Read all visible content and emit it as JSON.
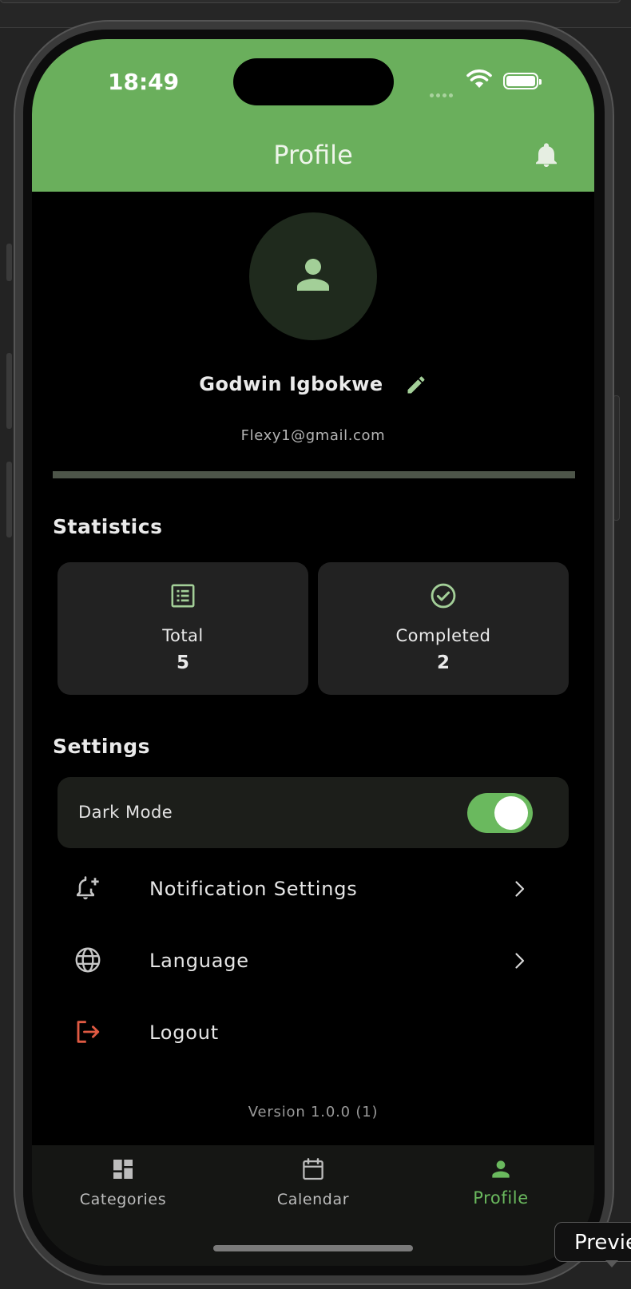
{
  "status_bar": {
    "time": "18:49"
  },
  "appbar": {
    "title": "Profile"
  },
  "profile": {
    "name": "Godwin Igbokwe",
    "email": "Flexy1@gmail.com"
  },
  "statistics": {
    "title": "Statistics",
    "total_label": "Total",
    "total_value": "5",
    "completed_label": "Completed",
    "completed_value": "2"
  },
  "settings": {
    "title": "Settings",
    "dark_mode_label": "Dark Mode",
    "dark_mode_on": true,
    "items": [
      {
        "label": "Notification Settings",
        "icon": "bell-plus-icon"
      },
      {
        "label": "Language",
        "icon": "globe-icon"
      },
      {
        "label": "Logout",
        "icon": "logout-icon"
      }
    ]
  },
  "version": "Version 1.0.0 (1)",
  "bottom_nav": {
    "items": [
      {
        "label": "Categories",
        "icon": "dashboard-icon"
      },
      {
        "label": "Calendar",
        "icon": "calendar-icon"
      },
      {
        "label": "Profile",
        "icon": "person-icon",
        "active": true
      }
    ]
  },
  "simulator": {
    "preview_tooltip": "Previe"
  },
  "colors": {
    "accent": "#6ab95e",
    "appbar": "#6aaf5c",
    "logout": "#e05a43"
  }
}
